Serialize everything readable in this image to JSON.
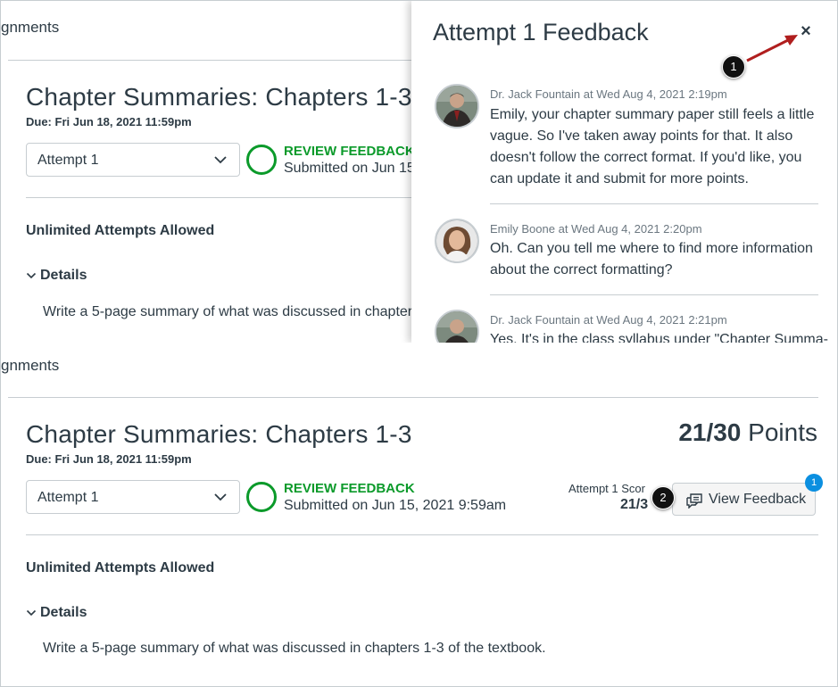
{
  "top": {
    "breadcrumb": "ɡnments",
    "title": "Chapter Summaries: Chapters 1-3",
    "due": "Due: Fri Jun 18, 2021 11:59pm",
    "attempt_select": "Attempt 1",
    "status": "REVIEW FEEDBACK",
    "submitted": "Submitted on Jun 15",
    "unlimited": "Unlimited Attempts Allowed",
    "details": "Details",
    "description": "Write a 5-page summary of what was discussed in chapters"
  },
  "tray": {
    "title": "Attempt 1 Feedback",
    "close_icon": "×",
    "comments": [
      {
        "meta": "Dr. Jack Fountain at Wed Aug 4, 2021 2:19pm",
        "text": "Emily, your chapter summary paper still feels a little vague. So I've taken away points for that. It also doesn't follow the correct format. If you'd like, you can update it and submit for more points."
      },
      {
        "meta": "Emily Boone at Wed Aug 4, 2021 2:20pm",
        "text": "Oh. Can you tell me where to find more information about the correct formatting?"
      },
      {
        "meta": "Dr. Jack Fountain at Wed Aug 4, 2021 2:21pm",
        "text": "Yes. It's in the class syllabus under \"Chapter Summa-"
      }
    ]
  },
  "bottom": {
    "breadcrumb": "ɡnments",
    "title": "Chapter Summaries: Chapters 1-3",
    "points_value": "21/30",
    "points_label": "Points",
    "due": "Due: Fri Jun 18, 2021 11:59pm",
    "attempt_select": "Attempt 1",
    "status": "REVIEW FEEDBACK",
    "submitted": "Submitted on Jun 15, 2021 9:59am",
    "score_label": "Attempt 1 Scor",
    "score_value": "21/3",
    "view_feedback": "View Feedback",
    "feedback_badge": "1",
    "unlimited": "Unlimited Attempts Allowed",
    "details": "Details",
    "description": "Write a 5-page summary of what was discussed in chapters 1-3 of the textbook."
  },
  "callouts": [
    "1",
    "2"
  ],
  "colors": {
    "status_green": "#0b9a2a",
    "badge_blue": "#0b8fe0",
    "arrow_red": "#b01e1e"
  },
  "icons": [
    "chevron-down-icon",
    "chevron-expand-icon",
    "close-icon",
    "comment-feedback-icon"
  ]
}
